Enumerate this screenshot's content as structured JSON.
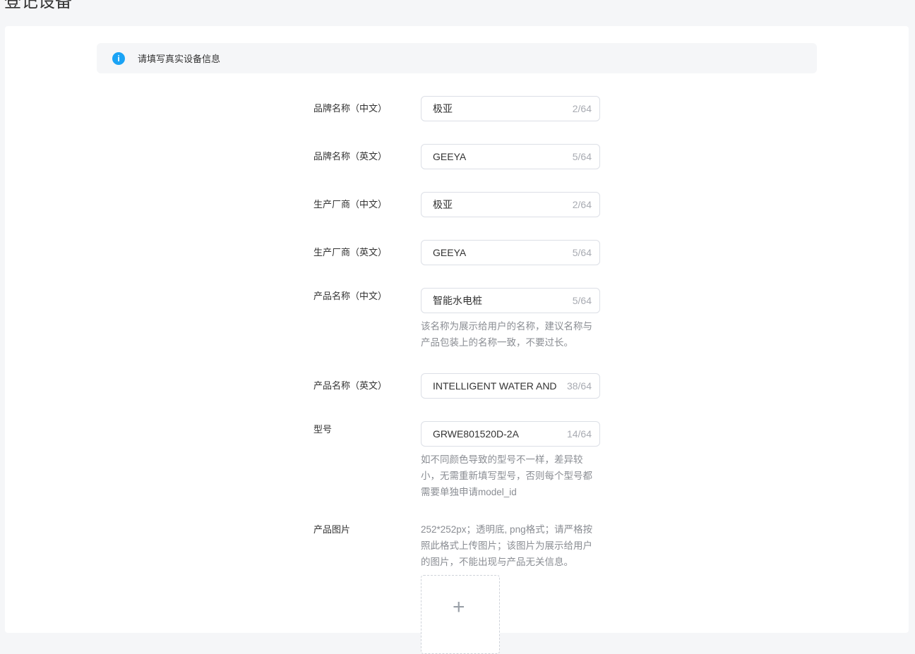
{
  "page": {
    "title": "登记设备"
  },
  "notice": {
    "icon": "info-icon",
    "text": "请填写真实设备信息"
  },
  "fields": {
    "brand_cn": {
      "label": "品牌名称（中文）",
      "value": "极亚",
      "counter": "2/64"
    },
    "brand_en": {
      "label": "品牌名称（英文）",
      "value": "GEEYA",
      "counter": "5/64"
    },
    "maker_cn": {
      "label": "生产厂商（中文）",
      "value": "极亚",
      "counter": "2/64"
    },
    "maker_en": {
      "label": "生产厂商（英文）",
      "value": "GEEYA",
      "counter": "5/64"
    },
    "product_cn": {
      "label": "产品名称（中文）",
      "value": "智能水电桩",
      "counter": "5/64",
      "hint": "该名称为展示给用户的名称，建议名称与产品包装上的名称一致，不要过长。"
    },
    "product_en": {
      "label": "产品名称（英文）",
      "value": "INTELLIGENT WATER AND",
      "counter": "38/64"
    },
    "model": {
      "label": "型号",
      "value": "GRWE801520D-2A",
      "counter": "14/64",
      "hint": "如不同颜色导致的型号不一样，差异较小，无需重新填写型号，否则每个型号都需要单独申请model_id"
    },
    "image": {
      "label": "产品图片",
      "hint": "252*252px；透明底, png格式；请严格按照此格式上传图片；该图片为展示给用户的图片，不能出现与产品无关信息。",
      "upload_icon": "+"
    }
  },
  "colors": {
    "accent": "#1aa3f5",
    "background": "#f5f6f8"
  }
}
